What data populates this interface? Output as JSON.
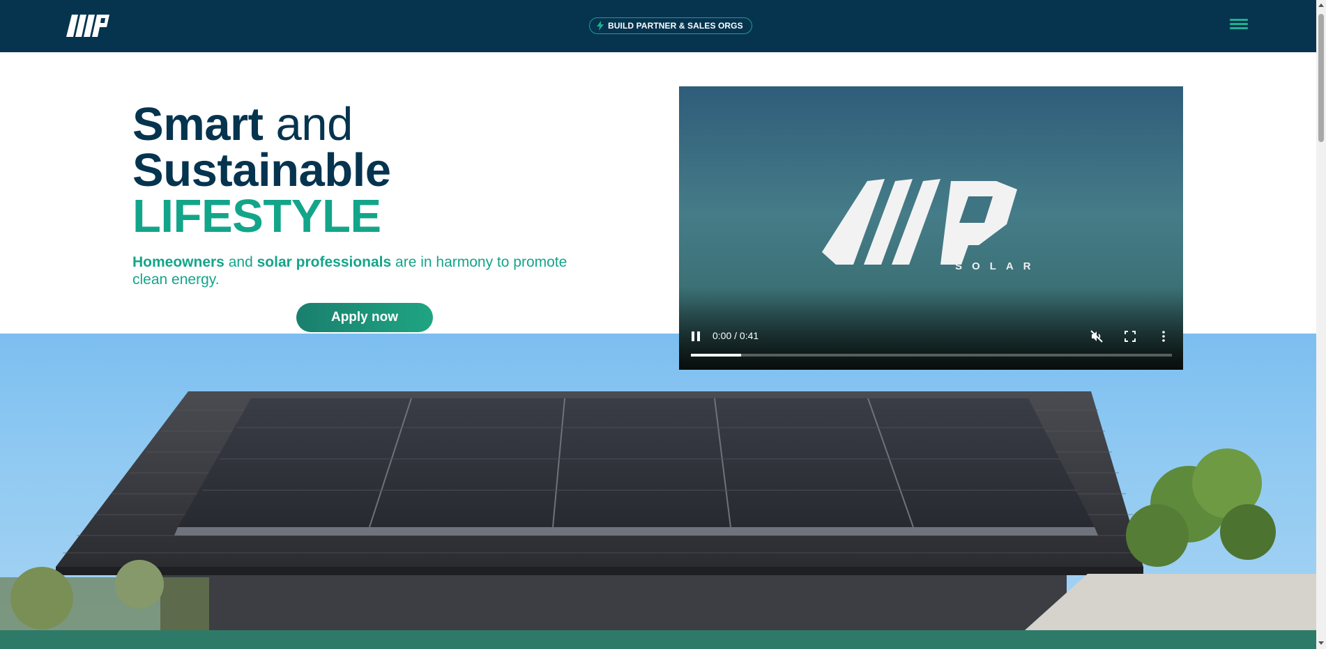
{
  "navbar": {
    "logo_alt": "WP logo",
    "promo_label": "BUILD PARTNER & SALES ORGS",
    "promo_icon": "lightning-icon",
    "menu_icon": "hamburger-menu-icon"
  },
  "hero": {
    "title_word1": "Smart",
    "title_word2": "and",
    "title_word3": "Sustainable",
    "title_word4": "LIFESTYLE",
    "subtitle_part1": "Homeowners",
    "subtitle_part2": "and",
    "subtitle_part3": "solar professionals",
    "subtitle_part4": "are in harmony to promote clean energy.",
    "apply_label": "Apply now"
  },
  "video": {
    "logo_text": "SOLAR",
    "time": "0:00 / 0:41",
    "progress_fraction": 0.105,
    "state": "playing",
    "muted": true
  },
  "colors": {
    "navy": "#06344f",
    "teal": "#13a58a",
    "band": "#2e7a68"
  }
}
